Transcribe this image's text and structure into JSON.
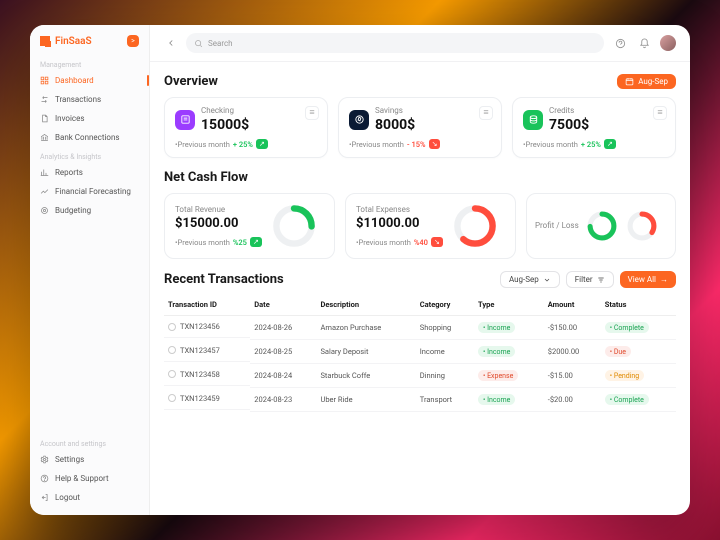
{
  "brand": {
    "name": "FinSaaS",
    "badge": ">"
  },
  "sidebar": {
    "sections": {
      "management": "Management",
      "analytics": "Analytics & Insights",
      "account": "Account and settings"
    },
    "items": {
      "dashboard": "Dashboard",
      "transactions": "Transactions",
      "invoices": "Invoices",
      "bank": "Bank Connections",
      "reports": "Reports",
      "forecasting": "Financial Forecasting",
      "budgeting": "Budgeting",
      "settings": "Settings",
      "help": "Help & Support",
      "logout": "Logout"
    }
  },
  "search": {
    "placeholder": "Search"
  },
  "overview": {
    "title": "Overview",
    "period_label": "Aug-Sep",
    "cards": {
      "checking": {
        "label": "Checking",
        "value": "15000$",
        "prev_label": "•Previous month",
        "delta": "+ 25%",
        "direction": "up"
      },
      "savings": {
        "label": "Savings",
        "value": "8000$",
        "prev_label": "•Previous month",
        "delta": "- 15%",
        "direction": "down"
      },
      "credits": {
        "label": "Credits",
        "value": "7500$",
        "prev_label": "•Previous month",
        "delta": "+ 25%",
        "direction": "up"
      }
    }
  },
  "cashflow": {
    "title": "Net Cash Flow",
    "revenue": {
      "label": "Total Revenue",
      "value": "$15000.00",
      "prev_label": "•Previous month",
      "delta": "%25",
      "direction": "up"
    },
    "expenses": {
      "label": "Total Expenses",
      "value": "$11000.00",
      "prev_label": "•Previous month",
      "delta": "%40",
      "direction": "down"
    },
    "profitloss_label": "Profit / Loss"
  },
  "transactions": {
    "title": "Recent Transactions",
    "period_label": "Aug-Sep",
    "filter_label": "Filter",
    "view_all_label": "View All",
    "columns": {
      "id": "Transaction ID",
      "date": "Date",
      "desc": "Description",
      "cat": "Category",
      "type": "Type",
      "amount": "Amount",
      "status": "Status"
    },
    "rows": [
      {
        "id": "TXN123456",
        "date": "2024-08-26",
        "desc": "Amazon Purchase",
        "cat": "Shopping",
        "type": "Income",
        "type_kind": "income",
        "amount": "-$150.00",
        "status": "Complete",
        "status_kind": "complete"
      },
      {
        "id": "TXN123457",
        "date": "2024-08-25",
        "desc": "Salary Deposit",
        "cat": "Income",
        "type": "Income",
        "type_kind": "income",
        "amount": "$2000.00",
        "status": "Due",
        "status_kind": "due"
      },
      {
        "id": "TXN123458",
        "date": "2024-08-24",
        "desc": "Starbuck Coffe",
        "cat": "Dinning",
        "type": "Expense",
        "type_kind": "expense",
        "amount": "-$15.00",
        "status": "Pending",
        "status_kind": "pending"
      },
      {
        "id": "TXN123459",
        "date": "2024-08-23",
        "desc": "Uber Ride",
        "cat": "Transport",
        "type": "Income",
        "type_kind": "income",
        "amount": "-$20.00",
        "status": "Complete",
        "status_kind": "complete"
      }
    ]
  }
}
